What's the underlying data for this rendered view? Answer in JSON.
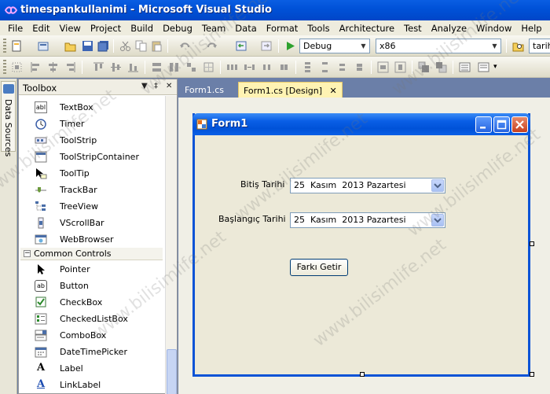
{
  "window": {
    "title": "timespankullanimi - Microsoft Visual Studio"
  },
  "menu": [
    "File",
    "Edit",
    "View",
    "Project",
    "Build",
    "Debug",
    "Team",
    "Data",
    "Format",
    "Tools",
    "Architecture",
    "Test",
    "Analyze",
    "Window",
    "Help"
  ],
  "toolbar": {
    "config_value": "Debug",
    "platform_value": "x86",
    "find_value": "tarih"
  },
  "data_sources": {
    "label": "Data Sources"
  },
  "toolbox": {
    "title": "Toolbox",
    "pin": "▾ ₽ ✕",
    "items_top": [
      "TextBox",
      "Timer",
      "ToolStrip",
      "ToolStripContainer",
      "ToolTip",
      "TrackBar",
      "TreeView",
      "VScrollBar",
      "WebBrowser"
    ],
    "category": "Common Controls",
    "items_common": [
      "Pointer",
      "Button",
      "CheckBox",
      "CheckedListBox",
      "ComboBox",
      "DateTimePicker",
      "Label",
      "LinkLabel"
    ]
  },
  "tabs": [
    {
      "label": "Form1.cs"
    },
    {
      "label": "Form1.cs [Design]",
      "close": "✕"
    }
  ],
  "form": {
    "title": "Form1",
    "bitis_label": "Bitiş Tarihi",
    "bitis_value": "25  Kasım  2013 Pazartesi",
    "baslangic_label": "Başlangıç Tarihi",
    "baslangic_value": "25  Kasım  2013 Pazartesi",
    "button_label": "Farkı Getir"
  },
  "watermark": "www.bilisimlife.net",
  "colors": {
    "accent": "#0a53d6",
    "tab_active": "#fff3b3",
    "form_bg": "#ece9d8"
  }
}
